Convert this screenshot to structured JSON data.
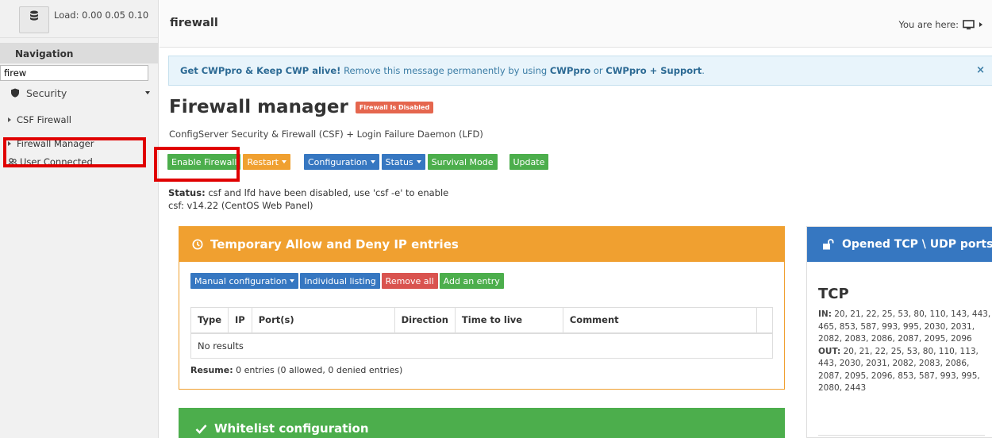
{
  "sidebar": {
    "load_label": "Load:",
    "load_values": "0.00  0.05  0.10",
    "nav_header": "Navigation",
    "search_value": "firew",
    "section_label": "Security",
    "items": [
      {
        "label": "CSF Firewall"
      },
      {
        "label": "Firewall Manager"
      }
    ],
    "user_connected": "User Connected"
  },
  "topbar": {
    "title": "firewall",
    "breadcrumb_label": "You are here:"
  },
  "alert": {
    "bold_start": "Get CWPpro & Keep CWP alive!",
    "text": " Remove this message permanently by using ",
    "link1": "CWPpro",
    "or": " or ",
    "link2": "CWPpro + Support",
    "end": ".",
    "close": "×"
  },
  "page": {
    "title": "Firewall manager",
    "badge": "Firewall Is Disabled",
    "subtitle": "ConfigServer Security & Firewall (CSF) + Login Failure Daemon (LFD)"
  },
  "toolbar": {
    "enable": "Enable Firewall",
    "restart": "Restart",
    "configuration": "Configuration",
    "status": "Status",
    "survival": "Survival Mode",
    "update": "Update"
  },
  "status": {
    "label": "Status:",
    "text": " csf and lfd have been disabled, use 'csf -e' to enable",
    "version": "csf: v14.22 (CentOS Web Panel)"
  },
  "temp_panel": {
    "title": "Temporary Allow and Deny IP entries",
    "buttons": {
      "manual": "Manual configuration",
      "individual": "Individual listing",
      "remove_all": "Remove all",
      "add": "Add an entry"
    },
    "columns": [
      "Type",
      "IP",
      "Port(s)",
      "Direction",
      "Time to live",
      "Comment"
    ],
    "empty": "No results",
    "resume_label": "Resume:",
    "resume_text": " 0 entries (0 allowed, 0 denied entries)"
  },
  "ports_panel": {
    "title": "Opened TCP \\ UDP ports",
    "tcp": "TCP",
    "in_label": "IN:",
    "in_ports": " 20, 21, 22, 25, 53, 80, 110, 143, 443, 465, 853, 587, 993, 995, 2030, 2031, 2082, 2083, 2086, 2087, 2095, 2096",
    "out_label": "OUT:",
    "out_ports": " 20, 21, 22, 25, 53, 80, 110, 113, 443, 2030, 2031, 2082, 2083, 2086, 2087, 2095, 2096, 853, 587, 993, 995, 2080, 2443"
  },
  "whitelist_panel": {
    "title": "Whitelist configuration"
  },
  "colors": {
    "green": "#4cae4c",
    "orange": "#f0a030",
    "blue": "#3677c1",
    "red": "#d9534f",
    "highlight": "#e00000"
  }
}
